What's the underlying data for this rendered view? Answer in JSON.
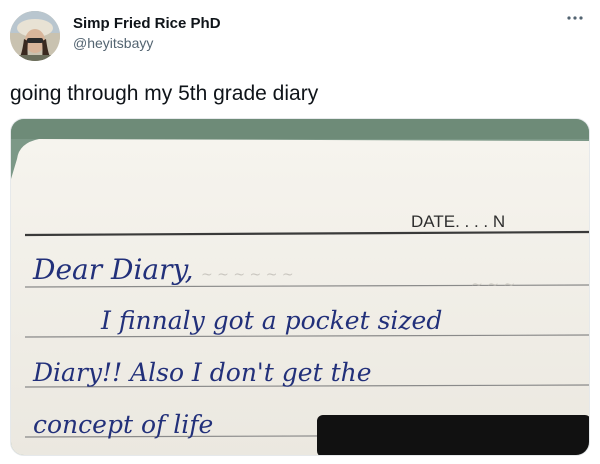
{
  "tweet": {
    "author": {
      "display_name": "Simp Fried Rice PhD",
      "handle": "@heyitsbayy"
    },
    "more_icon": "more-horizontal-icon",
    "text": "going through my 5th grade diary",
    "media": {
      "alt": "",
      "printed_header": "DATE. . . . N",
      "handwriting": [
        "Dear Diary,",
        "I finnaly got a pocket sized",
        "Diary!! Also I don't get the",
        "concept of life"
      ]
    }
  }
}
